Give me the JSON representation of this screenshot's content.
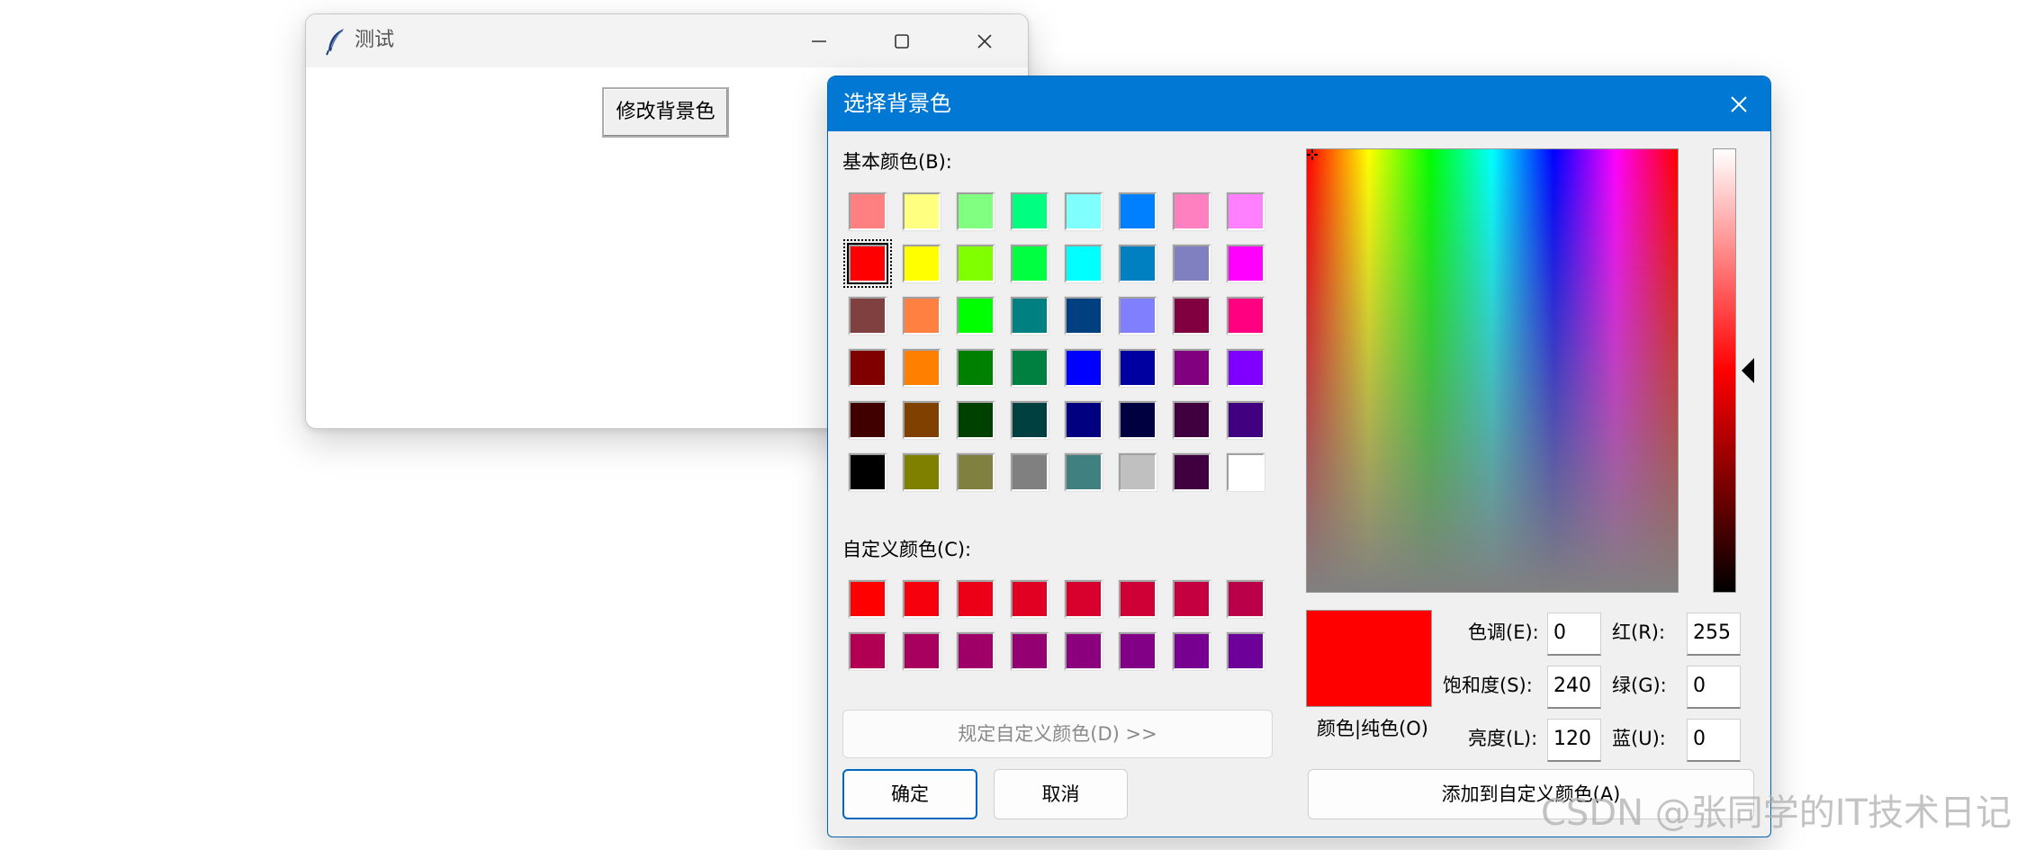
{
  "back_window": {
    "title": "测试",
    "modify_button": "修改背景色"
  },
  "dialog": {
    "title": "选择背景色",
    "basic_colors_label": "基本颜色(B):",
    "basic_colors": [
      "#ff8080",
      "#ffff80",
      "#80ff80",
      "#00ff80",
      "#80ffff",
      "#0080ff",
      "#ff80c0",
      "#ff80ff",
      "#ff0000",
      "#ffff00",
      "#80ff00",
      "#00ff40",
      "#00ffff",
      "#0080c0",
      "#8080c0",
      "#ff00ff",
      "#804040",
      "#ff8040",
      "#00ff00",
      "#008080",
      "#004080",
      "#8080ff",
      "#800040",
      "#ff0080",
      "#800000",
      "#ff8000",
      "#008000",
      "#008040",
      "#0000ff",
      "#0000a0",
      "#800080",
      "#8000ff",
      "#400000",
      "#804000",
      "#004000",
      "#004040",
      "#000080",
      "#000040",
      "#400040",
      "#400080",
      "#000000",
      "#808000",
      "#808040",
      "#808080",
      "#408080",
      "#c0c0c0",
      "#400040",
      "#ffffff"
    ],
    "selected_basic_color": "#ff0000",
    "custom_colors_label": "自定义颜色(C):",
    "custom_colors": [
      "#ff0000",
      "#f5000c",
      "#eb0018",
      "#e20022",
      "#d8002c",
      "#ce0036",
      "#c50040",
      "#bb004a",
      "#b10054",
      "#a8005e",
      "#9e0068",
      "#940072",
      "#8b007c",
      "#810086",
      "#770090",
      "#6e009a"
    ],
    "define_custom_button": "规定自定义颜色(D) >>",
    "ok_button": "确定",
    "cancel_button": "取消",
    "preview_label": "颜色|纯色(O)",
    "preview_color": "#ff0000",
    "fields": {
      "hue_label": "色调(E):",
      "hue": "0",
      "sat_label": "饱和度(S):",
      "sat": "240",
      "lum_label": "亮度(L):",
      "lum": "120",
      "red_label": "红(R):",
      "red": "255",
      "green_label": "绿(G):",
      "green": "0",
      "blue_label": "蓝(U):",
      "blue": "0"
    },
    "add_custom_button": "添加到自定义颜色(A)"
  },
  "watermark": "CSDN @张同学的IT技术日记"
}
